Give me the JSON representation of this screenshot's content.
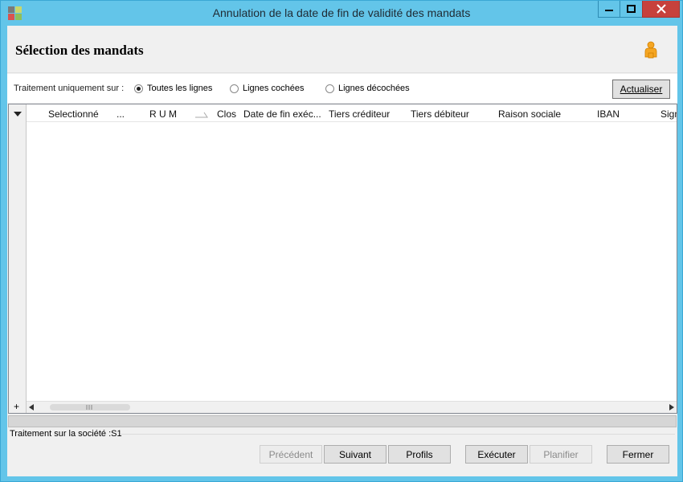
{
  "window": {
    "title": "Annulation de la date de fin de validité des mandats",
    "colors": {
      "frame": "#63c5e9",
      "close": "#c7413c"
    }
  },
  "header": {
    "title": "Sélection des mandats",
    "user_icon": "user-icon"
  },
  "filter": {
    "label": "Traitement uniquement sur :",
    "options": [
      "Toutes les lignes",
      "Lignes cochées",
      "Lignes décochées"
    ],
    "selected": "Toutes les lignes",
    "refresh_label": "Actualiser"
  },
  "grid": {
    "columns": [
      "Selectionné",
      "...",
      "R U M",
      "Clos",
      "Date de fin exéc...",
      "Tiers créditeur",
      "Tiers débiteur",
      "Raison sociale",
      "IBAN",
      "Signa"
    ],
    "rows": [],
    "add_label": "+"
  },
  "status": {
    "text": "Traitement sur la société :S1"
  },
  "footer": {
    "buttons": [
      {
        "label": "Précédent",
        "enabled": false
      },
      {
        "label": "Suivant",
        "enabled": true
      },
      {
        "label": "Profils",
        "enabled": true
      },
      {
        "label": "Exécuter",
        "enabled": true
      },
      {
        "label": "Planifier",
        "enabled": false
      },
      {
        "label": "Fermer",
        "enabled": true
      }
    ]
  }
}
